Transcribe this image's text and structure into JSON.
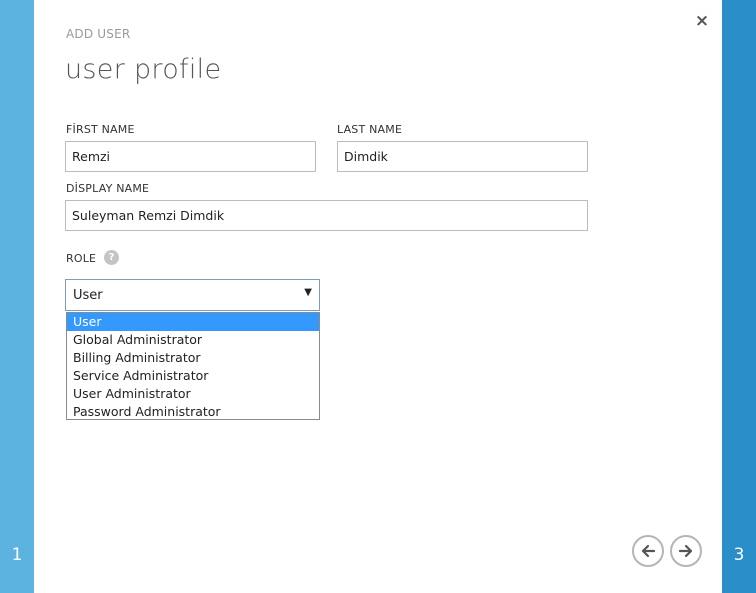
{
  "wizard": {
    "step_left": "1",
    "step_right": "3",
    "eyebrow": "ADD USER",
    "title": "user profile",
    "close_icon": "×"
  },
  "form": {
    "first_name": {
      "label": "FİRST NAME",
      "value": "Remzi"
    },
    "last_name": {
      "label": "LAST NAME",
      "value": "Dimdik"
    },
    "display_name": {
      "label": "DİSPLAY NAME",
      "value": "Suleyman Remzi Dimdik"
    },
    "role": {
      "label": "ROLE",
      "help_icon": "?",
      "selected": "User",
      "options": [
        "User",
        "Global Administrator",
        "Billing Administrator",
        "Service Administrator",
        "User Administrator",
        "Password Administrator"
      ]
    }
  },
  "icons": {
    "close": "close-icon",
    "help": "question-mark-icon",
    "back": "arrow-left-icon",
    "next": "arrow-right-icon",
    "caret": "caret-down-icon"
  },
  "colors": {
    "left_rail": "#5cb3df",
    "right_rail": "#2a8ec8",
    "selection": "#3399ff"
  }
}
